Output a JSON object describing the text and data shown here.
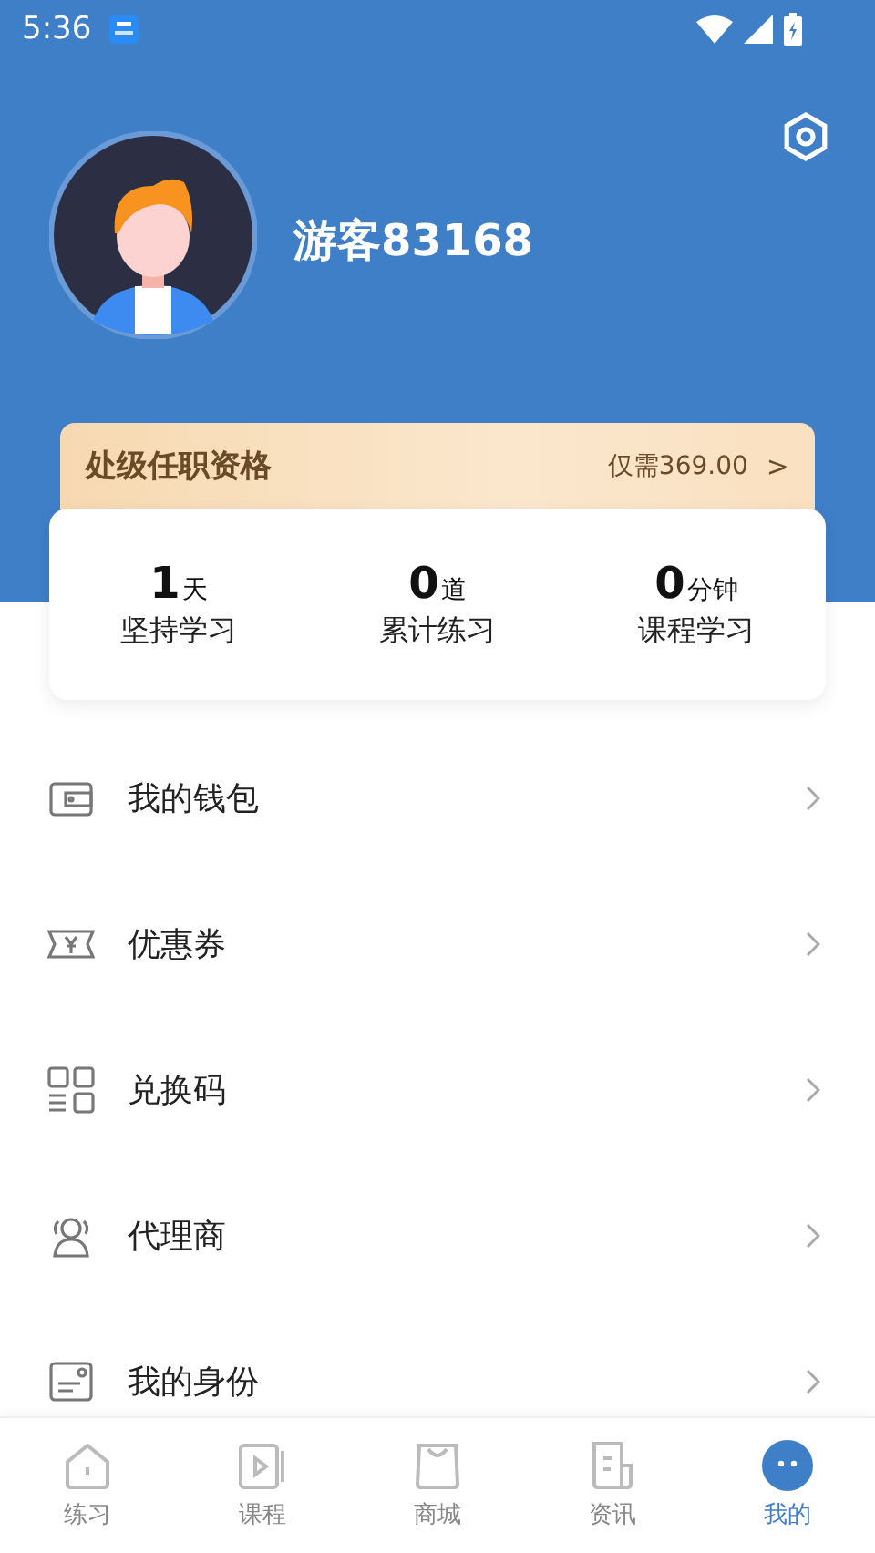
{
  "status_bar": {
    "time": "5:36"
  },
  "profile": {
    "name": "游客83168"
  },
  "promo": {
    "title": "处级任职资格",
    "price": "仅需369.00",
    "chevron": ">"
  },
  "stats": [
    {
      "value": "1",
      "unit": "天",
      "label": "坚持学习"
    },
    {
      "value": "0",
      "unit": "道",
      "label": "累计练习"
    },
    {
      "value": "0",
      "unit": "分钟",
      "label": "课程学习"
    }
  ],
  "menu": [
    {
      "kind": "wallet",
      "label": "我的钱包"
    },
    {
      "kind": "coupon",
      "label": "优惠券"
    },
    {
      "kind": "code",
      "label": "兑换码"
    },
    {
      "kind": "agent",
      "label": "代理商"
    },
    {
      "kind": "identity",
      "label": "我的身份"
    }
  ],
  "tabs": [
    {
      "kind": "home",
      "label": "练习",
      "selected": false
    },
    {
      "kind": "video",
      "label": "课程",
      "selected": false
    },
    {
      "kind": "bag",
      "label": "商城",
      "selected": false
    },
    {
      "kind": "news",
      "label": "资讯",
      "selected": false
    },
    {
      "kind": "face",
      "label": "我的",
      "selected": true
    }
  ]
}
